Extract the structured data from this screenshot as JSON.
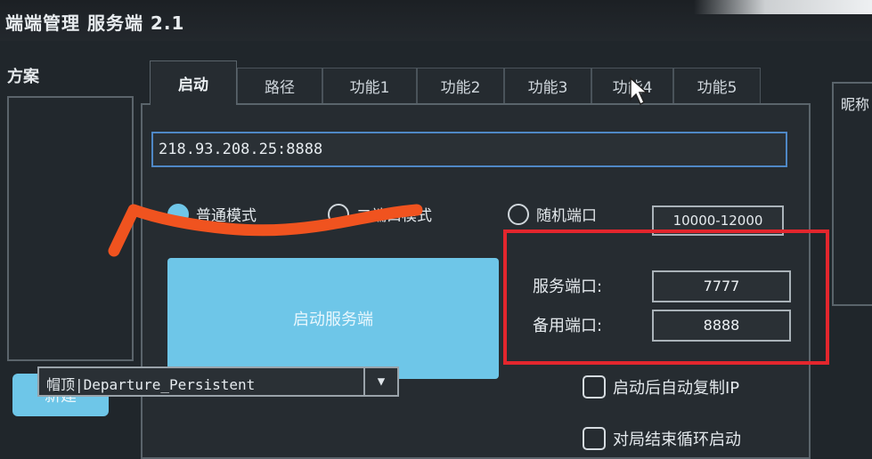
{
  "window": {
    "title": "端端管理 服务端 2.1"
  },
  "left_panel": {
    "label": "方案",
    "new_button": "新建"
  },
  "tabs": [
    "启动",
    "路径",
    "功能1",
    "功能2",
    "功能3",
    "功能4",
    "功能5"
  ],
  "start_tab": {
    "address": "218.93.208.25:8888",
    "modes": [
      {
        "label": "普通模式",
        "selected": true
      },
      {
        "label": "二端口模式",
        "selected": false
      },
      {
        "label": "随机端口",
        "selected": false
      }
    ],
    "port_range": "10000-12000",
    "start_button": "启动服务端",
    "service_port_label": "服务端口:",
    "service_port": "7777",
    "backup_port_label": "备用端口:",
    "backup_port": "8888",
    "copy_ip_checkbox": "启动后自动复制IP",
    "loop_checkbox": "对局结束循环启动",
    "dropdown_value": "帽顶|Departure_Persistent"
  },
  "right_panel": {
    "label": "昵称"
  },
  "colors": {
    "accent": "#6ec6e8",
    "annotation_red": "#e3262d",
    "scribble_orange": "#f0531f",
    "input_border": "#4f88c6"
  }
}
